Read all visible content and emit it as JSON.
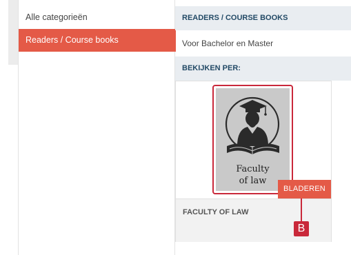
{
  "sidebar": {
    "items": [
      {
        "label": "Alle categorieën",
        "active": false
      },
      {
        "label": "Readers / Course books",
        "active": true
      }
    ]
  },
  "main": {
    "section_header": "READERS / COURSE BOOKS",
    "subtitle": "Voor Bachelor en Master",
    "view_by_header": "BEKIJKEN PER:",
    "card": {
      "image_text_line1": "Faculty",
      "image_text_line2": "of law",
      "button_label": "BLADEREN",
      "title": "FACULTY OF LAW"
    },
    "callout_label": "B"
  },
  "colors": {
    "accent": "#e45a47",
    "callout": "#c9283a",
    "header_bg": "#e9edf1",
    "header_text": "#234a66"
  }
}
